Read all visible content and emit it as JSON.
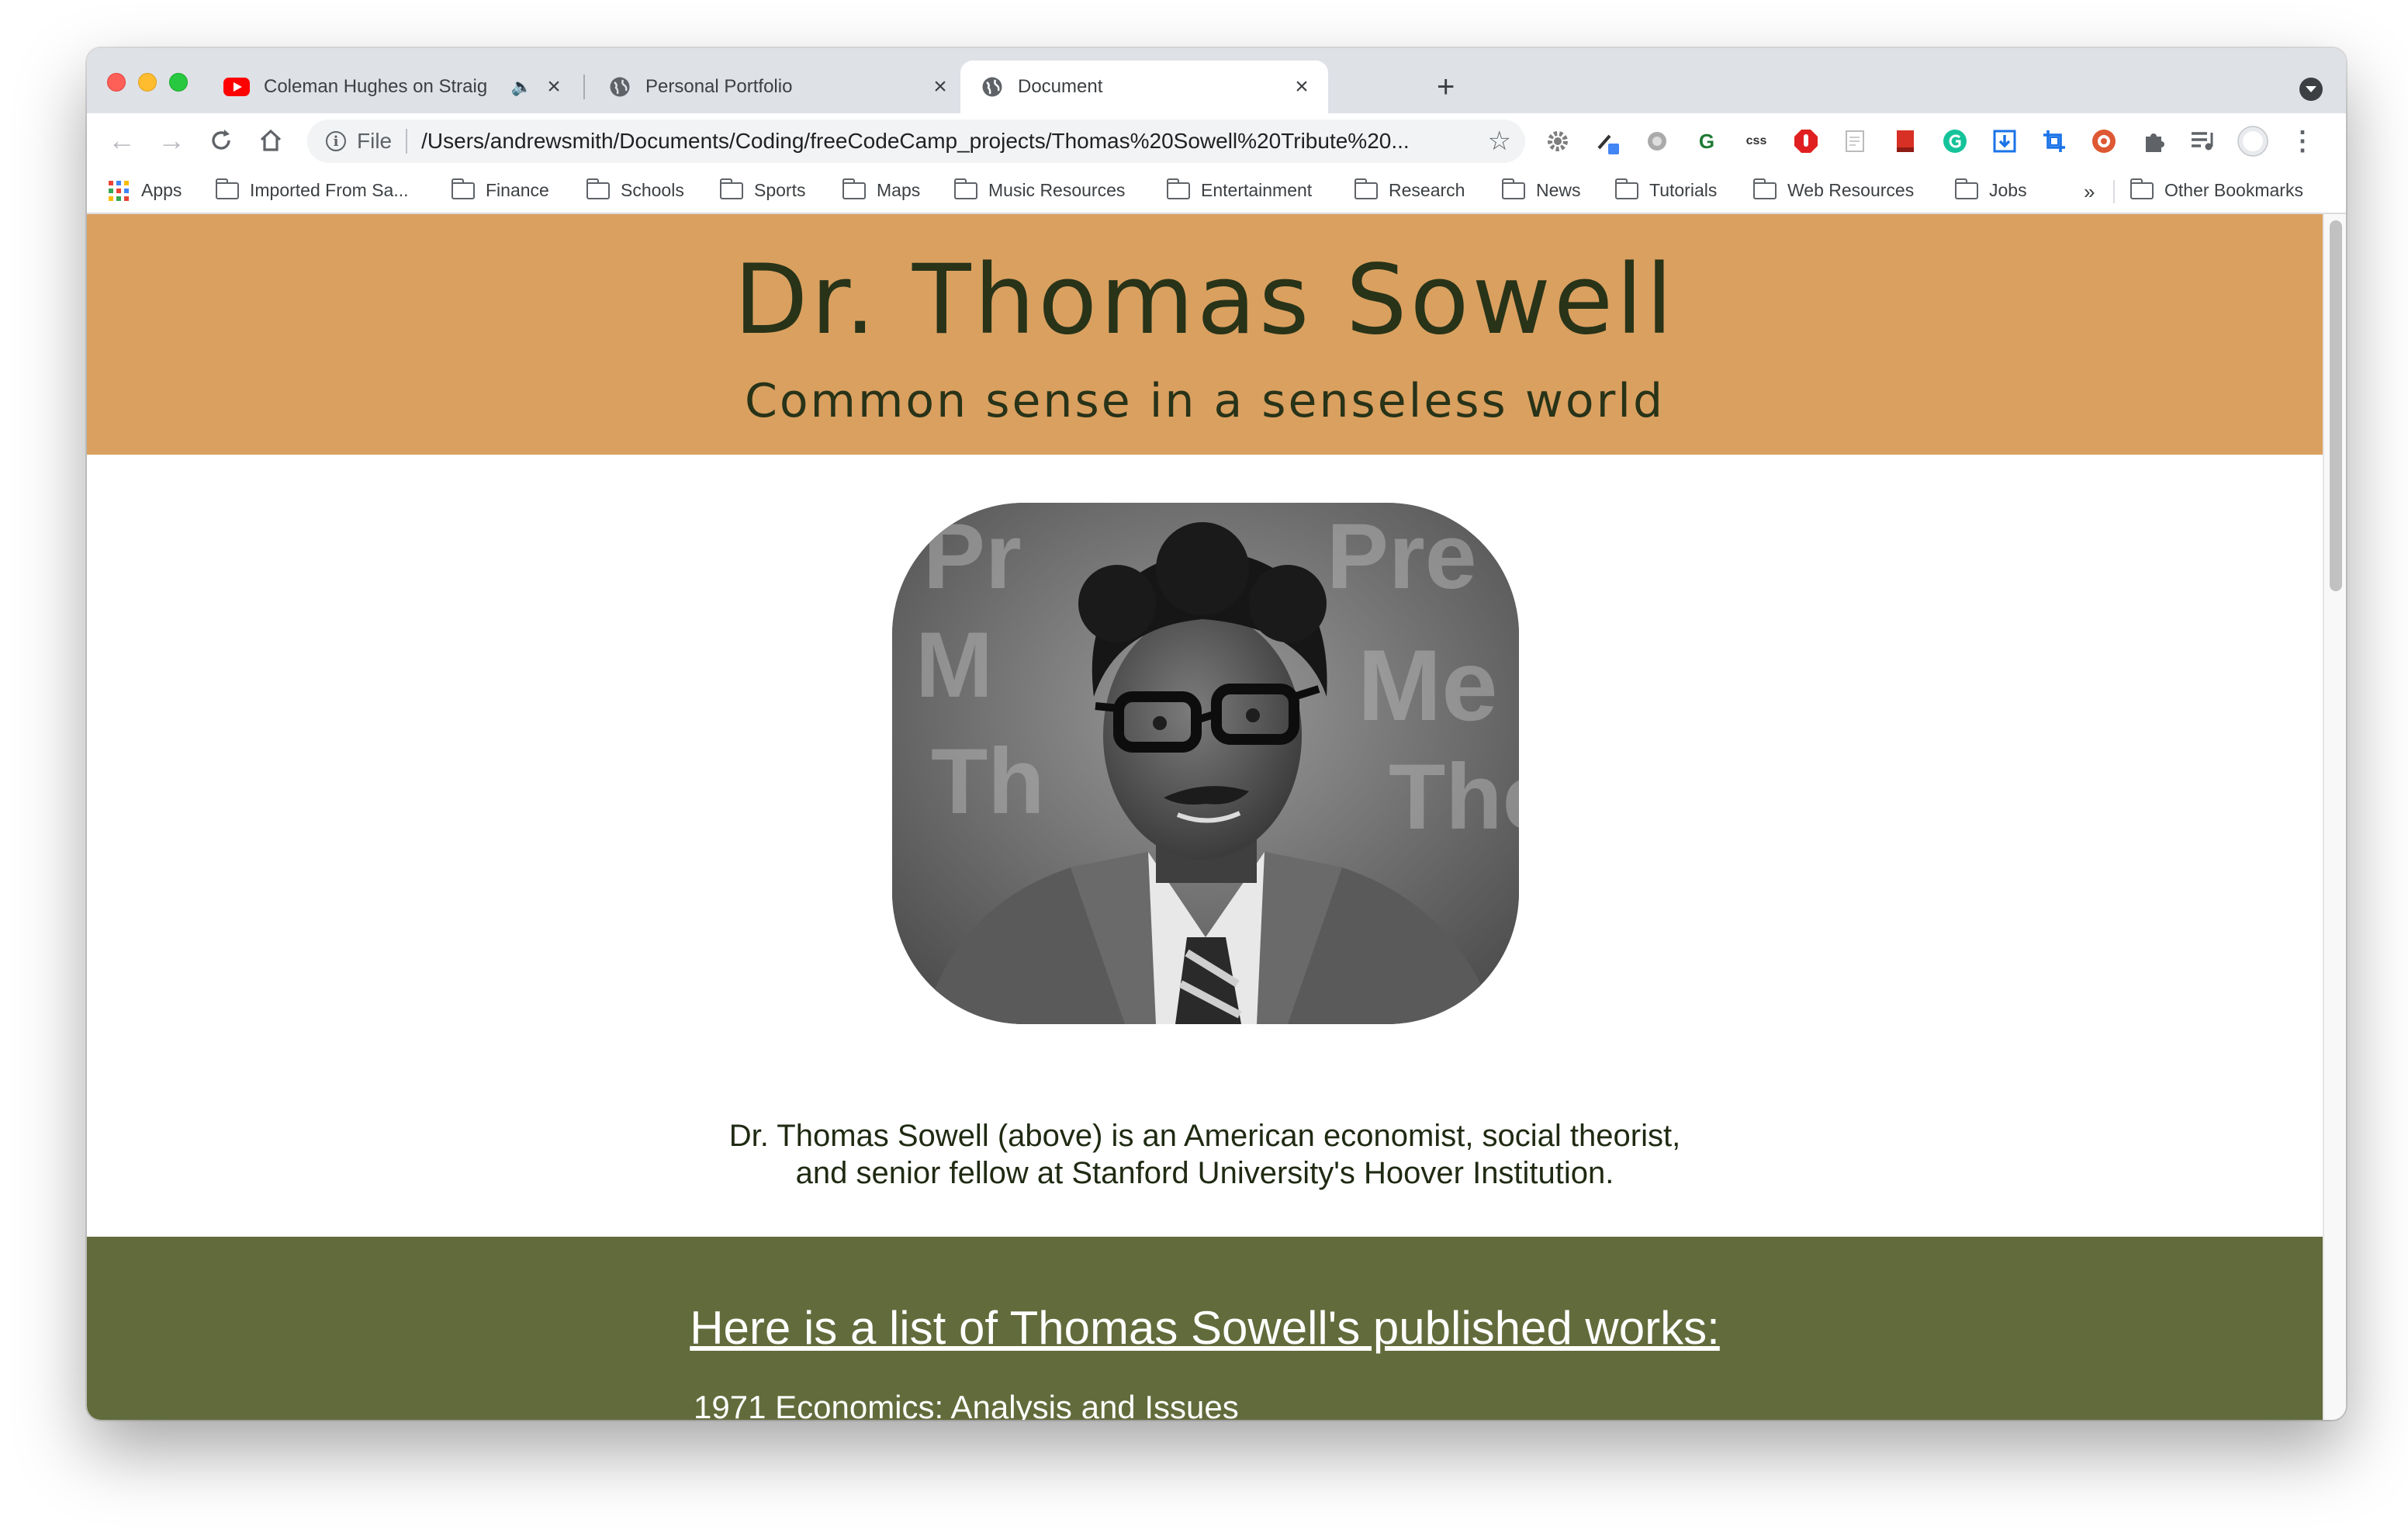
{
  "browser": {
    "tabs": [
      {
        "title": "Coleman Hughes on Straig",
        "favicon": "youtube-icon",
        "audio": true
      },
      {
        "title": "Personal Portfolio",
        "favicon": "globe-icon"
      },
      {
        "title": "Document",
        "favicon": "globe-icon",
        "active": true
      }
    ],
    "omnibox": {
      "scheme": "File",
      "url": "/Users/andrewsmith/Documents/Coding/freeCodeCamp_projects/Thomas%20Sowell%20Tribute%20..."
    },
    "extensions": [
      "gear-extension-icon",
      "eyedropper-extension-icon",
      "globe-extension-icon",
      "G",
      "css",
      "adblock-icon",
      "notes-icon",
      "red-book-icon",
      "grammarly-icon",
      "download-icon",
      "crop-icon",
      "duckduckgo-icon",
      "puzzle-icon",
      "media-icon",
      "profile-icon",
      "more-icon"
    ],
    "ext_labels": {
      "g": "G",
      "css": "css"
    },
    "bookmarks": {
      "apps": "Apps",
      "items": [
        "Imported From Sa...",
        "Finance",
        "Schools",
        "Sports",
        "Maps",
        "Music Resources",
        "Entertainment",
        "Research",
        "News",
        "Tutorials",
        "Web Resources",
        "Jobs"
      ],
      "overflow": "»",
      "other": "Other Bookmarks"
    }
  },
  "page": {
    "title": "Dr. Thomas Sowell",
    "subtitle": "Common sense in a senseless world",
    "caption_line1": "Dr. Thomas Sowell (above) is an American economist, social theorist,",
    "caption_line2": "and senior fellow at Stanford University's Hoover Institution.",
    "works_heading": "Here is a list of Thomas Sowell's published works:",
    "first_work": "1971  Economics: Analysis and Issues"
  },
  "colors": {
    "header_bg": "#daa060",
    "header_text": "#283318",
    "works_bg": "#626b3b"
  }
}
